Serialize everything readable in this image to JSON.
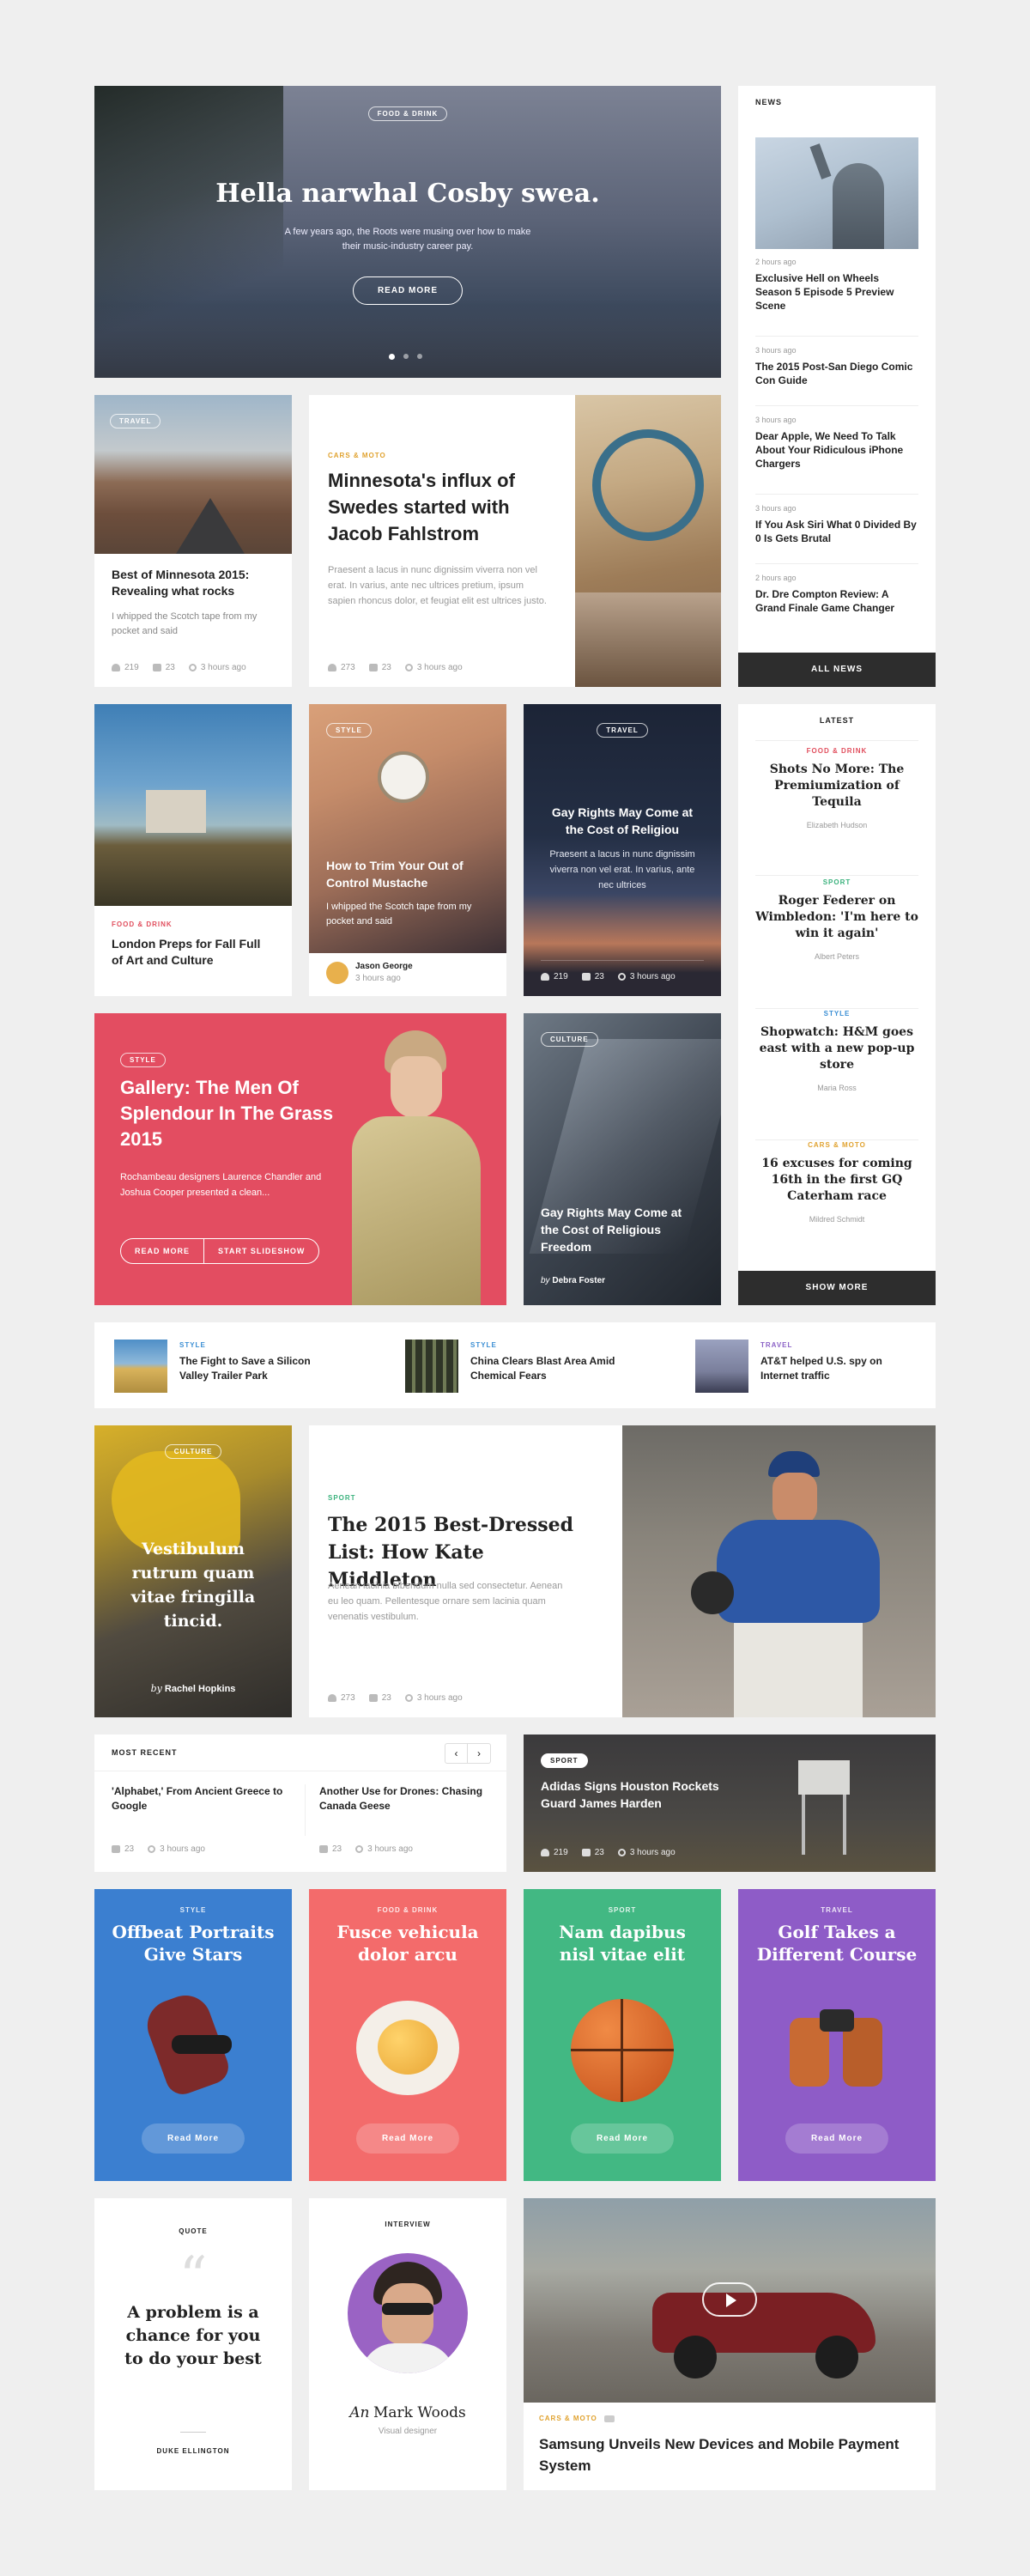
{
  "hero": {
    "category": "Food & Drink",
    "title": "Hella narwhal Cosby swea.",
    "description": "A few years ago, the Roots were musing over how to make their music-industry career pay.",
    "button": "Read More"
  },
  "news": {
    "heading": "News",
    "items": [
      {
        "time": "2 hours ago",
        "title": "Exclusive Hell on Wheels Season 5 Episode 5 Preview Scene"
      },
      {
        "time": "3 hours ago",
        "title": "The 2015 Post-San Diego Comic Con Guide"
      },
      {
        "time": "3 hours ago",
        "title": "Dear Apple, We Need To Talk About Your Ridiculous iPhone Chargers"
      },
      {
        "time": "3 hours ago",
        "title": "If You Ask Siri What 0 Divided By 0 Is Gets Brutal"
      },
      {
        "time": "2 hours ago",
        "title": "Dr. Dre Compton Review: A Grand Finale Game Changer"
      }
    ],
    "all_button": "All News"
  },
  "travel_card": {
    "category": "Travel",
    "title": "Best of Minnesota 2015: Revealing what rocks",
    "excerpt": "I whipped the Scotch tape from my pocket and said",
    "likes": "219",
    "comments": "23",
    "time": "3 hours ago"
  },
  "feature": {
    "category": "Cars & Moto",
    "title": "Minnesota's influx of Swedes started with Jacob Fahlstrom",
    "excerpt": "Praesent a lacus in nunc dignissim viverra non vel erat. In varius, ante nec ultrices pretium, ipsum sapien rhoncus dolor, et feugiat elit est ultrices justo.",
    "likes": "273",
    "comments": "23",
    "time": "3 hours ago"
  },
  "london": {
    "category": "Food & Drink",
    "title": "London Preps for Fall Full of Art and Culture"
  },
  "mustache": {
    "category": "Style",
    "title": "How to Trim Your Out of Control Mustache",
    "excerpt": "I whipped the Scotch tape from my pocket and said",
    "author": "Jason George",
    "time": "3 hours ago"
  },
  "gay_travel": {
    "category": "Travel",
    "title": "Gay Rights May Come at the Cost of Religiou",
    "excerpt": "Praesent a lacus in nunc dignissim viverra non vel erat. In varius, ante nec ultrices",
    "likes": "219",
    "comments": "23",
    "time": "3 hours ago"
  },
  "latest": {
    "heading": "Latest",
    "items": [
      {
        "category": "Food & Drink",
        "title": "Shots No More: The Premiumization of Tequila",
        "author": "Elizabeth Hudson",
        "color": "#e14f5e"
      },
      {
        "category": "Sport",
        "title": "Roger Federer on Wimbledon: 'I'm here to win it again'",
        "author": "Albert Peters",
        "color": "#3bb27d"
      },
      {
        "category": "Style",
        "title": "Shopwatch: H&M goes east with a new pop-up store",
        "author": "Maria Ross",
        "color": "#3b8fd4"
      },
      {
        "category": "Cars & Moto",
        "title": "16 excuses for coming 16th in the first GQ Caterham race",
        "author": "Mildred Schmidt",
        "color": "#e0a22f"
      }
    ],
    "show_button": "Show More"
  },
  "gallery": {
    "category": "Style",
    "title": "Gallery: The Men Of Splendour In The Grass 2015",
    "excerpt": "Rochambeau designers Laurence Chandler and Joshua Cooper presented a clean...",
    "btn1": "Read More",
    "btn2": "Start Slideshow"
  },
  "culture": {
    "category": "Culture",
    "title": "Gay Rights May Come at the Cost of Religious Freedom",
    "byline_prefix": "by",
    "author": "Debra Foster"
  },
  "strip": [
    {
      "category": "Style",
      "title": "The Fight to Save a Silicon Valley Trailer Park",
      "color": "#3b8fd4"
    },
    {
      "category": "Style",
      "title": "China Clears Blast Area Amid Chemical Fears",
      "color": "#3b8fd4"
    },
    {
      "category": "Travel",
      "title": "AT&T helped U.S. spy on Internet traffic",
      "color": "#8b62c6"
    }
  ],
  "vestibulum": {
    "category": "Culture",
    "title": "Vestibulum rutrum quam vitae fringilla tincid.",
    "byline_prefix": "by",
    "author": "Rachel Hopkins"
  },
  "best_dressed": {
    "category": "Sport",
    "title": "The 2015 Best-Dressed List: How Kate Middleton",
    "excerpt": "Aenean lacinia bibendum nulla sed consectetur. Aenean eu leo quam. Pellentesque ornare sem lacinia quam venenatis vestibulum.",
    "likes": "273",
    "comments": "23",
    "time": "3 hours ago"
  },
  "most_recent": {
    "heading": "Most Recent",
    "items": [
      {
        "title": "'Alphabet,' From Ancient Greece to Google",
        "comments": "23",
        "time": "3 hours ago"
      },
      {
        "title": "Another Use for Drones: Chasing Canada Geese",
        "comments": "23",
        "time": "3 hours ago"
      }
    ]
  },
  "adidas": {
    "category": "Sport",
    "title": "Adidas Signs Houston Rockets Guard James Harden",
    "likes": "219",
    "comments": "23",
    "time": "3 hours ago"
  },
  "color_cards": [
    {
      "category": "Style",
      "title": "Offbeat Portraits Give Stars",
      "button": "Read More",
      "color": "#3b7fd0"
    },
    {
      "category": "Food & Drink",
      "title": "Fusce vehicula dolor arcu",
      "button": "Read More",
      "color": "#f36b6b"
    },
    {
      "category": "Sport",
      "title": "Nam dapibus nisl vitae elit",
      "button": "Read More",
      "color": "#42b883"
    },
    {
      "category": "Travel",
      "title": "Golf Takes a Different Course",
      "button": "Read More",
      "color": "#8e5cc7"
    }
  ],
  "quote": {
    "label": "Quote",
    "mark": "“",
    "text": "A problem is a chance for you to do your best",
    "author": "Duke Ellington"
  },
  "interview": {
    "label": "Interview",
    "name_prefix": "An",
    "name": "Mark Woods",
    "role": "Visual designer"
  },
  "samsung": {
    "category": "Cars & Moto",
    "title": "Samsung Unveils New Devices and Mobile Payment System"
  }
}
